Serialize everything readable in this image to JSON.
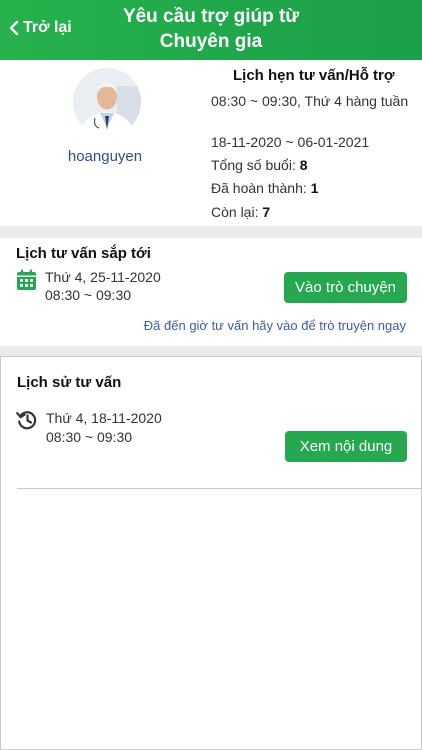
{
  "header": {
    "back_label": "Trở lại",
    "title_line1": "Yêu cầu trợ giúp từ",
    "title_line2": "Chuyên gia"
  },
  "profile": {
    "username": "hoanguyen",
    "schedule_title": "Lịch hẹn tư vấn/Hỗ trợ",
    "time_recurrence": "08:30 ~ 09:30, Thứ 4 hàng tuần",
    "date_range": "18-11-2020 ~ 06-01-2021",
    "total_label": "Tổng số buổi: ",
    "total_value": "8",
    "completed_label": "Đã hoàn thành: ",
    "completed_value": "1",
    "remaining_label": "Còn lại: ",
    "remaining_value": "7"
  },
  "upcoming": {
    "title": "Lịch tư vấn sắp tới",
    "date": "Thứ 4, 25-11-2020",
    "time": "08:30 ~ 09:30",
    "chat_button": "Vào trò chuyện",
    "hint": "Đã đến giờ tư vấn hãy vào để trò truyện ngay"
  },
  "history": {
    "title": "Lịch sử tư vấn",
    "items": [
      {
        "date": "Thứ 4, 18-11-2020",
        "time": "08:30 ~ 09:30",
        "button": "Xem nội dung"
      }
    ]
  },
  "colors": {
    "accent_green": "#25a850",
    "link_blue": "#3f5ba8"
  },
  "icons": {
    "back": "chevron-left-icon",
    "calendar": "calendar-icon",
    "history": "history-clock-icon"
  }
}
